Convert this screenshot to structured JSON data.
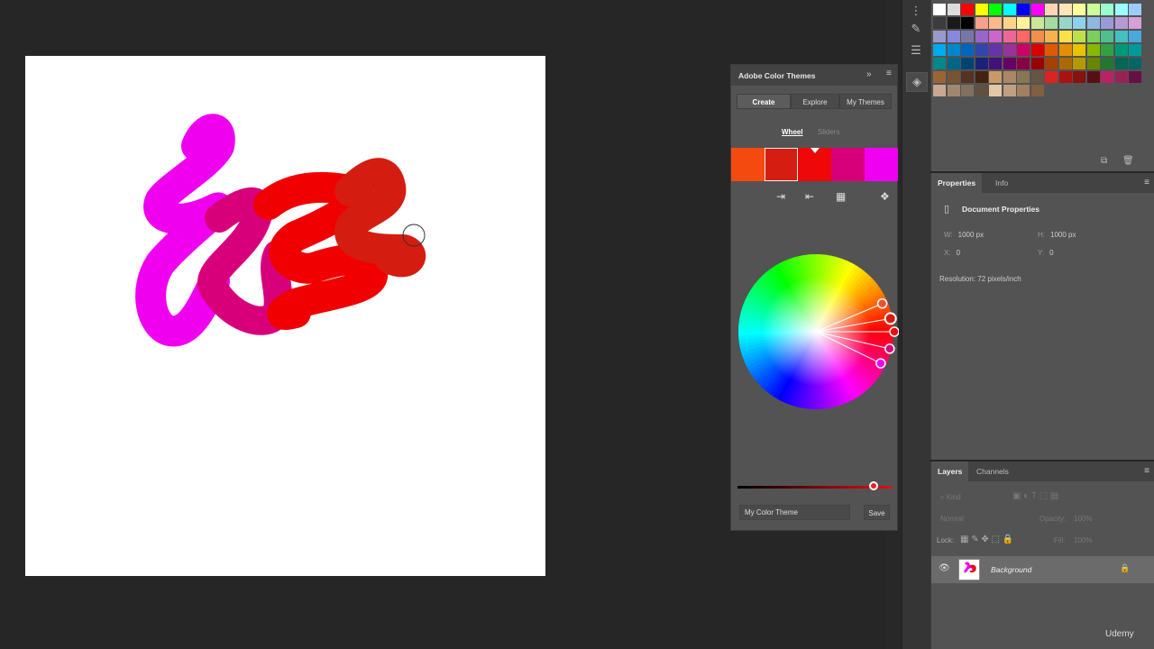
{
  "colors": {
    "brush_magenta": "#ef00ef",
    "brush_pink": "#d8007a",
    "brush_red": "#f00000",
    "brush_darkred": "#d41d10",
    "panel_bg": "#535353",
    "panel_header": "#434343",
    "app_bg": "#262626"
  },
  "color_themes": {
    "title": "Adobe Color Themes",
    "tabs": [
      "Create",
      "Explore",
      "My Themes"
    ],
    "active_tab": "Create",
    "subtabs": [
      "Wheel",
      "Sliders"
    ],
    "active_subtab": "Wheel",
    "swatches": [
      "#f54a0f",
      "#d61d12",
      "#ee0808",
      "#d8007a",
      "#f000f0"
    ],
    "selected_swatch": 1,
    "brightness_percent": 88,
    "theme_name": "My Color Theme",
    "save_label": "Save",
    "icons": [
      "add-from-fg-icon",
      "add-from-bg-icon",
      "grid-icon",
      "harmony-icon"
    ]
  },
  "properties": {
    "tabs": [
      "Properties",
      "Info"
    ],
    "active_tab": "Properties",
    "section_title": "Document Properties",
    "w_label": "W:",
    "w_value": "1000 px",
    "h_label": "H:",
    "h_value": "1000 px",
    "x_label": "X:",
    "x_value": "0",
    "y_label": "Y:",
    "y_value": "0",
    "resolution": "Resolution: 72 pixels/inch"
  },
  "layers": {
    "tabs": [
      "Layers",
      "Channels"
    ],
    "active_tab": "Layers",
    "kind_placeholder": "Kind",
    "blend_mode": "Normal",
    "opacity_label": "Opacity:",
    "opacity_value": "100%",
    "lock_label": "Lock:",
    "fill_label": "Fill:",
    "fill_value": "100%",
    "layer_name": "Background"
  },
  "watermark": "Udemy"
}
